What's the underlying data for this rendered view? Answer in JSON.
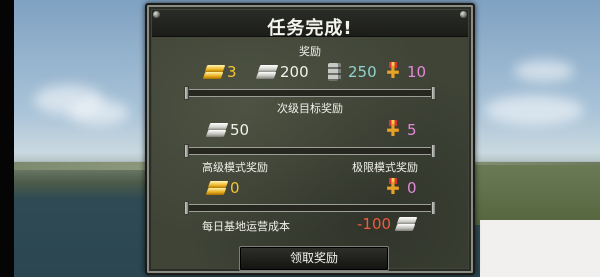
{
  "dialog": {
    "title": "任务完成!",
    "reward_header": "奖励",
    "secondary_header": "次级目标奖励",
    "advanced_header": "高级模式奖励",
    "extreme_header": "极限模式奖励",
    "daily_cost_label": "每日基地运营成本",
    "confirm_button": "领取奖励"
  },
  "rewards": {
    "gold": "3",
    "silver": "200",
    "fuel": "250",
    "medals": "10"
  },
  "secondary": {
    "silver": "50",
    "medals": "5"
  },
  "advanced": {
    "gold": "0"
  },
  "extreme": {
    "medals": "0"
  },
  "daily_cost": {
    "value": "-100"
  },
  "icons": [
    "gold-bar-icon",
    "silver-bar-icon",
    "fuel-barrel-icon",
    "medal-icon"
  ],
  "colors": {
    "gold": "#f4c531",
    "silver": "#f2f2ec",
    "fuel": "#8fd3cf",
    "medal": "#e588d8",
    "cost": "#f15a3c"
  }
}
